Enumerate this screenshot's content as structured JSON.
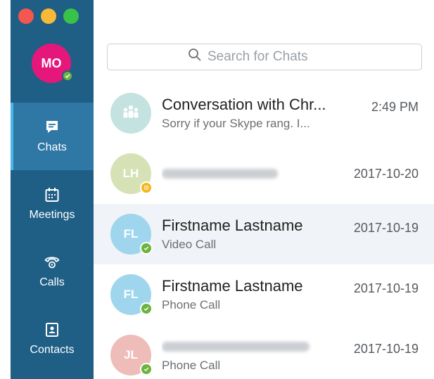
{
  "sidebar": {
    "me": {
      "initials": "MO",
      "avatar_color": "#e5177b",
      "status": "online"
    },
    "nav": [
      {
        "id": "chats",
        "label": "Chats",
        "icon": "chat-bubble-icon",
        "active": true
      },
      {
        "id": "meetings",
        "label": "Meetings",
        "icon": "calendar-icon",
        "active": false
      },
      {
        "id": "calls",
        "label": "Calls",
        "icon": "phone-icon",
        "active": false
      },
      {
        "id": "contacts",
        "label": "Contacts",
        "icon": "contact-card-icon",
        "active": false
      }
    ]
  },
  "search": {
    "placeholder": "Search for Chats",
    "value": ""
  },
  "conversations": [
    {
      "initials": "",
      "avatar_color": "#c4e3e0",
      "title": "Conversation with Chr...",
      "subtitle": "Sorry if your Skype rang. I...",
      "date": "2:49 PM",
      "status": "none"
    },
    {
      "initials": "LH",
      "avatar_color": "#d6e2b6",
      "title": "",
      "subtitle": "",
      "date": "2017-10-20",
      "status": "away"
    },
    {
      "initials": "FL",
      "avatar_color": "#9fd6ee",
      "title": "Firstname Lastname",
      "subtitle": "Video Call",
      "date": "2017-10-19",
      "status": "online"
    },
    {
      "initials": "FL",
      "avatar_color": "#9fd6ee",
      "title": "Firstname Lastname",
      "subtitle": "Phone Call",
      "date": "2017-10-19",
      "status": "online"
    },
    {
      "initials": "JL",
      "avatar_color": "#eebdb9",
      "title": "",
      "subtitle": "Phone Call",
      "date": "2017-10-19",
      "status": "online"
    }
  ],
  "colors": {
    "sidebar": "#1f5f86",
    "sidebar_active": "#2f77a4",
    "accent": "#49b6ea",
    "online": "#6cb33f",
    "away": "#f5b81b"
  }
}
